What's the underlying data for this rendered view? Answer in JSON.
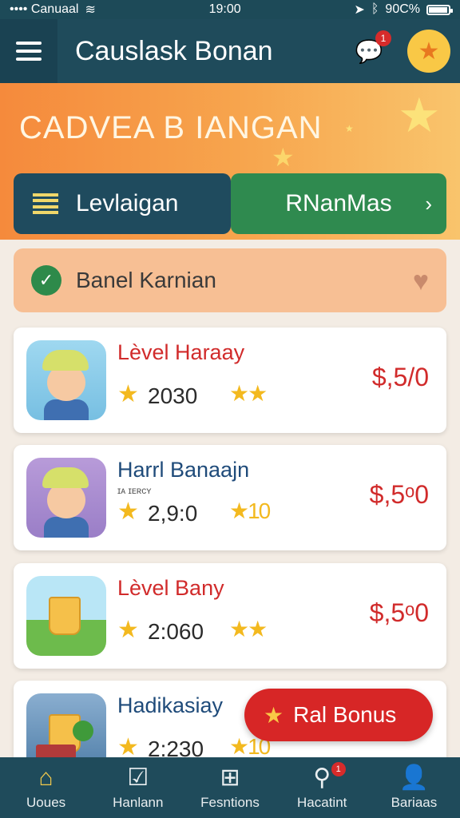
{
  "status_bar": {
    "carrier": "•••• Canuaal",
    "time": "19:00",
    "battery": "90C%",
    "battery_level": 0.9
  },
  "app_bar": {
    "title": "Causlask Bonan",
    "notification_count": "1"
  },
  "hero": {
    "title": "CADVEA B IANGAN"
  },
  "tabs": {
    "left_label": "Levlaigan",
    "right_label": "RNanMas",
    "right_chevron": "›"
  },
  "banner": {
    "label": "Banel Karnian"
  },
  "levels": [
    {
      "name": "Lèvel Haraay",
      "score": "2030",
      "price": "$,5/0",
      "stars": "★★",
      "sub": ""
    },
    {
      "name": "Harrl Banaajn",
      "score": "2,9:0",
      "price": "$,5ᵒ0",
      "stars": "★10",
      "sub": "ɪᴀ ɪᴇʀᴄʏ"
    },
    {
      "name": "Lèvel Bany",
      "score": "2:060",
      "price": "$,5ᵒ0",
      "stars": "★★",
      "sub": ""
    },
    {
      "name": "Hadikasiay",
      "score": "2:230",
      "price": "",
      "stars": "★10",
      "sub": ""
    }
  ],
  "bonus_button": {
    "label": "Ral Bonus"
  },
  "bottom_nav": [
    {
      "label": "Uoues",
      "icon": "home-icon"
    },
    {
      "label": "Hanlann",
      "icon": "checkbox-icon"
    },
    {
      "label": "Fesntions",
      "icon": "basket-icon"
    },
    {
      "label": "Hacatint",
      "icon": "search-icon",
      "badge": "1"
    },
    {
      "label": "Bariaas",
      "icon": "person-icon"
    }
  ],
  "colors": {
    "primary": "#1f4b5b",
    "hero_orange": "#f58a3c",
    "green_tab": "#2f8a4f",
    "price_red": "#d12b2b",
    "star_yellow": "#f3b91f"
  }
}
